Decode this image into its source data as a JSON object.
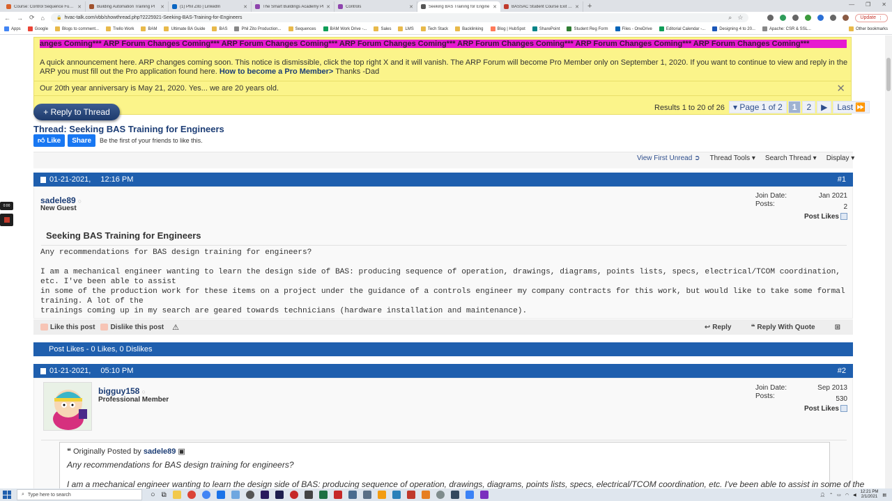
{
  "browser": {
    "tabs": [
      {
        "label": "Course: Control Sequence Funda",
        "color": "#d9622b"
      },
      {
        "label": "Building Automation Training Pl",
        "color": "#a0522d"
      },
      {
        "label": "(1) Phil Zito | LinkedIn",
        "color": "#0a66c2"
      },
      {
        "label": "The Smart Buildings Academy Pl",
        "color": "#8e44ad"
      },
      {
        "label": "Controls",
        "color": "#8e44ad"
      },
      {
        "label": "Seeking BAS Training for Engine",
        "color": "#555555"
      },
      {
        "label": "BASSAC Student Course Exit Eval",
        "color": "#c0392b"
      }
    ],
    "url": "hvac-talk.com/vbb/showthread.php?2225921-Seeking-BAS-Training-for-Engineers",
    "update_label": "Update",
    "bookmarks": [
      "Apps",
      "Google",
      "Blogs to comment...",
      "Trello Work",
      "BAM",
      "Ultimate BA Guide",
      "BAS",
      "Phil Zito Production...",
      "Sequences",
      "BAM Work Drive -...",
      "Sales",
      "LMS",
      "Tech Stack",
      "Backlinking",
      "Blog | HubSpot",
      "SharePoint",
      "Student Reg Form",
      "Files - OneDrive",
      "Editorial Calendar -...",
      "Designing 4 to 20...",
      "Apache: CSR & SSL..."
    ],
    "other_bookmarks": "Other bookmarks"
  },
  "notices": {
    "marquee": "anges Coming*** ARP Forum Changes Coming*** ARP Forum Changes Coming*** ARP Forum Changes Coming*** ARP Forum Changes Coming*** ARP Forum Changes Coming*** ARP Forum Changes Coming***",
    "announcement": "A quick announcement here. ARP changes coming soon. This notice is dismissible, click the top right X and it will vanish. The ARP Forum will become Pro Member only on September 1, 2020. If you want to continue to view and reply in the ARP you must fill out the Pro application found here.",
    "announcement_link": "How to become a Pro Member>",
    "announcement_tail": " Thanks -Dad",
    "anniversary": "Our 20th year anniversary is May 21, 2020. Yes... we are 20 years old.",
    "close_glyph": "✕"
  },
  "thread": {
    "reply_button": "+ Reply to Thread",
    "title": "Thread: Seeking BAS Training for Engineers",
    "fb_like": "Like",
    "fb_share": "Share",
    "fb_text": "Be the first of your friends to like this.",
    "results": "Results 1 to 20 of 26",
    "page_label": "Page 1 of 2",
    "pages": [
      "1",
      "2"
    ],
    "next": "▶",
    "last": "Last ⏩",
    "tools": {
      "view_first_unread": "View First Unread",
      "thread_tools": "Thread Tools",
      "search_thread": "Search Thread",
      "display": "Display"
    }
  },
  "posts": [
    {
      "date": "01-21-2021,",
      "time": "12:16 PM",
      "number": "#1",
      "username": "sadele89",
      "rank": "New Guest",
      "join_label": "Join Date:",
      "join_date": "Jan 2021",
      "posts_label": "Posts:",
      "post_count": "2",
      "post_likes": "Post Likes",
      "title": "Seeking BAS Training for Engineers",
      "line1": "Any recommendations for BAS design training for engineers?",
      "line2": "I am a mechanical engineer wanting to learn the design side of BAS: producing sequence of operation, drawings, diagrams, points lists, specs, electrical/TCOM coordination, etc. I've been able to assist",
      "line3": "in some of the production work for these items on a project under the guidance of a controls engineer my company contracts for this work, but would like to take some formal training. A lot of the",
      "line4": "trainings coming up in my search are geared towards technicians (hardware installation and maintenance).",
      "like": "Like this post",
      "dislike": "Dislike this post",
      "reply": "Reply",
      "reply_quote": "Reply With Quote",
      "likes_summary": "Post Likes - 0 Likes, 0 Dislikes"
    },
    {
      "date": "01-21-2021,",
      "time": "05:10 PM",
      "number": "#2",
      "username": "bigguy158",
      "rank": "Professional Member",
      "join_label": "Join Date:",
      "join_date": "Sep 2013",
      "posts_label": "Posts:",
      "post_count": "530",
      "post_likes": "Post Likes",
      "quote_prefix": "Originally Posted by",
      "quote_author": "sadele89",
      "quote_line1": "Any recommendations for BAS design training for engineers?",
      "quote_line2": "I am a mechanical engineer wanting to learn the design side of BAS: producing sequence of operation, drawings, diagrams, points lists, specs, electrical/TCOM coordination, etc. I've been able to assist in some of the"
    }
  ],
  "taskbar": {
    "search_placeholder": "Type here to search",
    "time": "12:21 PM",
    "date": "2/1/2021"
  },
  "overlay": {
    "recorder_time": "0:00"
  }
}
